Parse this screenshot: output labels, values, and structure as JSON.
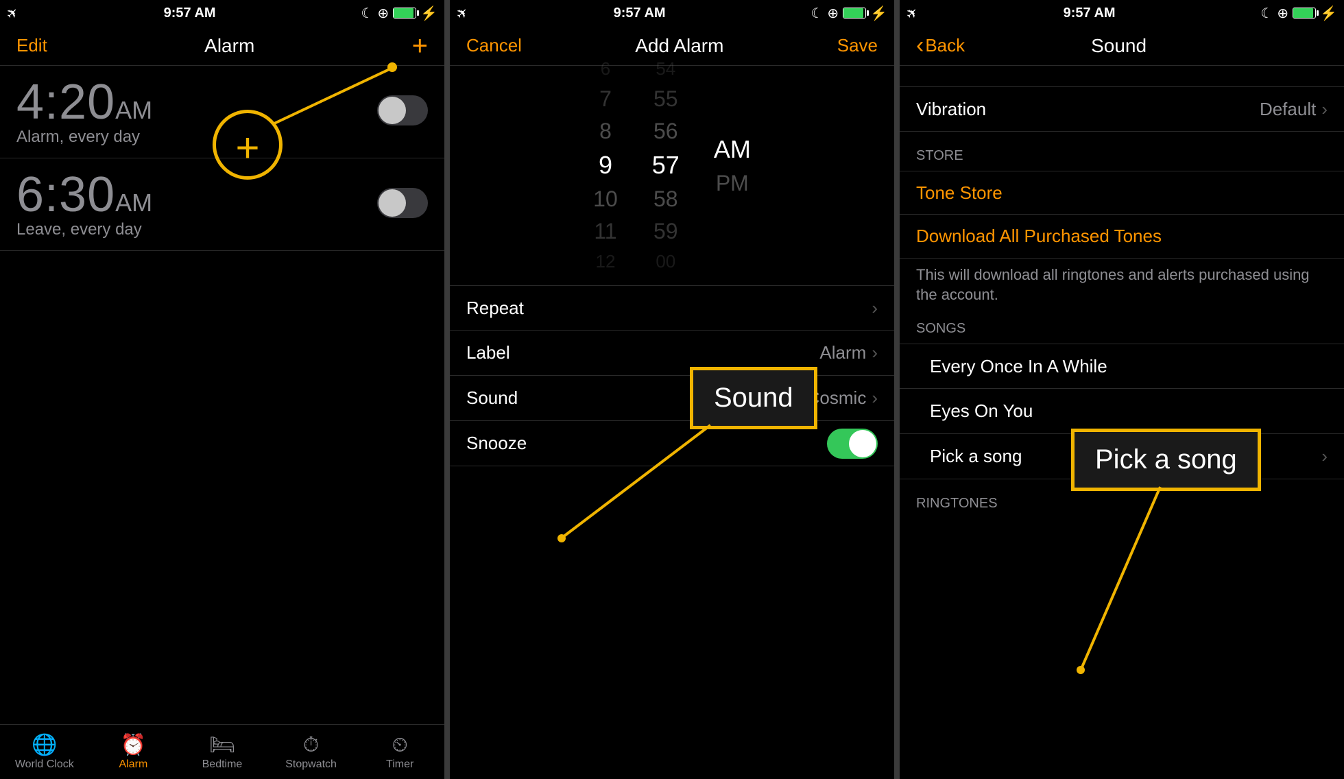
{
  "statusbar": {
    "time": "9:57 AM"
  },
  "screen1": {
    "edit": "Edit",
    "title": "Alarm",
    "alarms": [
      {
        "time": "4:20",
        "ampm": "AM",
        "sub": "Alarm, every day"
      },
      {
        "time": "6:30",
        "ampm": "AM",
        "sub": "Leave, every day"
      }
    ],
    "tabs": {
      "worldclock": "World Clock",
      "alarm": "Alarm",
      "bedtime": "Bedtime",
      "stopwatch": "Stopwatch",
      "timer": "Timer"
    }
  },
  "screen2": {
    "cancel": "Cancel",
    "title": "Add Alarm",
    "save": "Save",
    "picker": {
      "hours": [
        "6",
        "7",
        "8",
        "9",
        "10",
        "11",
        "12"
      ],
      "mins": [
        "54",
        "55",
        "56",
        "57",
        "58",
        "59",
        "00"
      ],
      "ampm": [
        "AM",
        "PM"
      ]
    },
    "rows": {
      "repeat": "Repeat",
      "label": "Label",
      "label_val": "Alarm",
      "sound": "Sound",
      "sound_val": "Cosmic",
      "snooze": "Snooze"
    }
  },
  "screen3": {
    "back": "Back",
    "title": "Sound",
    "vibration": "Vibration",
    "vibration_val": "Default",
    "store_header": "STORE",
    "tone_store": "Tone Store",
    "download": "Download All Purchased Tones",
    "download_desc": "This will download all ringtones and alerts purchased using the account.",
    "songs_header": "SONGS",
    "songs": [
      "Every Once In A While",
      "Eyes On You",
      "Pick a song"
    ],
    "ringtones_header": "RINGTONES"
  },
  "annotations": {
    "sound": "Sound",
    "pick": "Pick a song"
  }
}
